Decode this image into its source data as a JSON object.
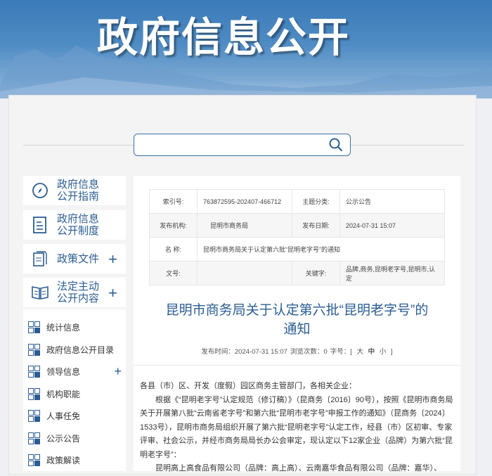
{
  "banner": {
    "title": "政府信息公开"
  },
  "search": {
    "placeholder": ""
  },
  "sidebar": {
    "main_items": [
      {
        "label": "政府信息公开指南",
        "line1": "政府信息",
        "line2": "公开指南",
        "icon": "compass-icon"
      },
      {
        "label": "政府信息公开制度",
        "line1": "政府信息",
        "line2": "公开制度",
        "icon": "document-icon"
      },
      {
        "label": "政策文件",
        "icon": "files-icon",
        "expand": "+"
      },
      {
        "label": "法定主动公开内容",
        "line1": "法定主动",
        "line2": "公开内容",
        "icon": "book-icon",
        "expand": "+"
      }
    ],
    "sub_items": [
      {
        "label": "统计信息"
      },
      {
        "label": "政府信息公开目录"
      },
      {
        "label": "领导信息",
        "expand": "+"
      },
      {
        "label": "机构职能"
      },
      {
        "label": "人事任免"
      },
      {
        "label": "公示公告"
      },
      {
        "label": "政策解读"
      }
    ]
  },
  "info_table": {
    "index_label": "索引号:",
    "index_value": "763872595-202407-466712",
    "category_label": "主题分类:",
    "category_value": "公示公告",
    "publisher_label": "发布机构:",
    "publisher_value": "昆明市商务局",
    "date_label": "发布日期:",
    "date_value": "2024-07-31 15:07",
    "name_label": "名 称:",
    "name_value": "昆明市商务局关于认定第六批“昆明老字号”的通知",
    "docno_label": "文号:",
    "docno_value": "",
    "keywords_label": "关键字:",
    "keywords_value": "品牌,商务,昆明老字号,昆明市,认定"
  },
  "article": {
    "title_line1": "昆明市商务局关于认定第六批“昆明老字号”的",
    "title_line2": "通知",
    "publish_time": "发布时间：2024-07-31 15:07",
    "views": "浏览次数：0",
    "font_size_label": "字号：[",
    "font_large": "大",
    "font_medium": "中",
    "font_small": "小",
    "font_close": "]",
    "para1": "各县（市）区、开发（度假）园区商务主管部门，各相关企业：",
    "para2": "根据《“昆明老字号”认定规范（修订稿）》（昆商务〔2016〕90号），按照《昆明市商务局关于开展第八批“云南省老字号”和第六批“昆明市老字号”申报工作的通知》（昆商务〔2024〕1533号），昆明市商务局组织开展了第六批“昆明老字号”认定工作，经县（市）区初审、专家评审、社会公示，并经市商务局局长办公会审定，现认定以下12家企业（品牌）为第六批“昆明老字号”：",
    "para3": "昆明高上高食品有限公司（品牌：高上高）、云南嘉华食品有限公司（品牌：嘉华）、"
  }
}
